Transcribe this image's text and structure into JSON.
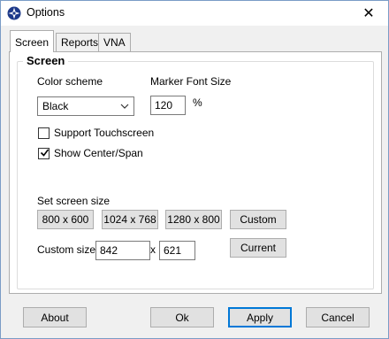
{
  "window": {
    "title": "Options",
    "close_glyph": "✕",
    "icon": "app-logo-icon"
  },
  "tabs": [
    {
      "label": "Screen",
      "active": true
    },
    {
      "label": "Reports",
      "active": false
    },
    {
      "label": "VNA",
      "active": false
    }
  ],
  "screen": {
    "group_title": "Screen",
    "color_scheme_label": "Color scheme",
    "color_scheme_value": "Black",
    "marker_font_label": "Marker Font Size",
    "marker_font_value": "120",
    "marker_font_unit": "%",
    "touchscreen_label": "Support Touchscreen",
    "touchscreen_checked": false,
    "center_span_label": "Show Center/Span",
    "center_span_checked": true,
    "set_size_label": "Set screen size",
    "size_buttons": [
      "800 x 600",
      "1024 x 768",
      "1280 x 800",
      "Custom"
    ],
    "custom_size_label": "Custom size:",
    "custom_width": "842",
    "custom_x": "x",
    "custom_height": "621",
    "current_button": "Current"
  },
  "dialog_buttons": {
    "about": "About",
    "ok": "Ok",
    "apply": "Apply",
    "cancel": "Cancel"
  },
  "colors": {
    "accent": "#0078d7",
    "button_face": "#e1e1e1",
    "panel_bg": "#f0f0f0"
  }
}
